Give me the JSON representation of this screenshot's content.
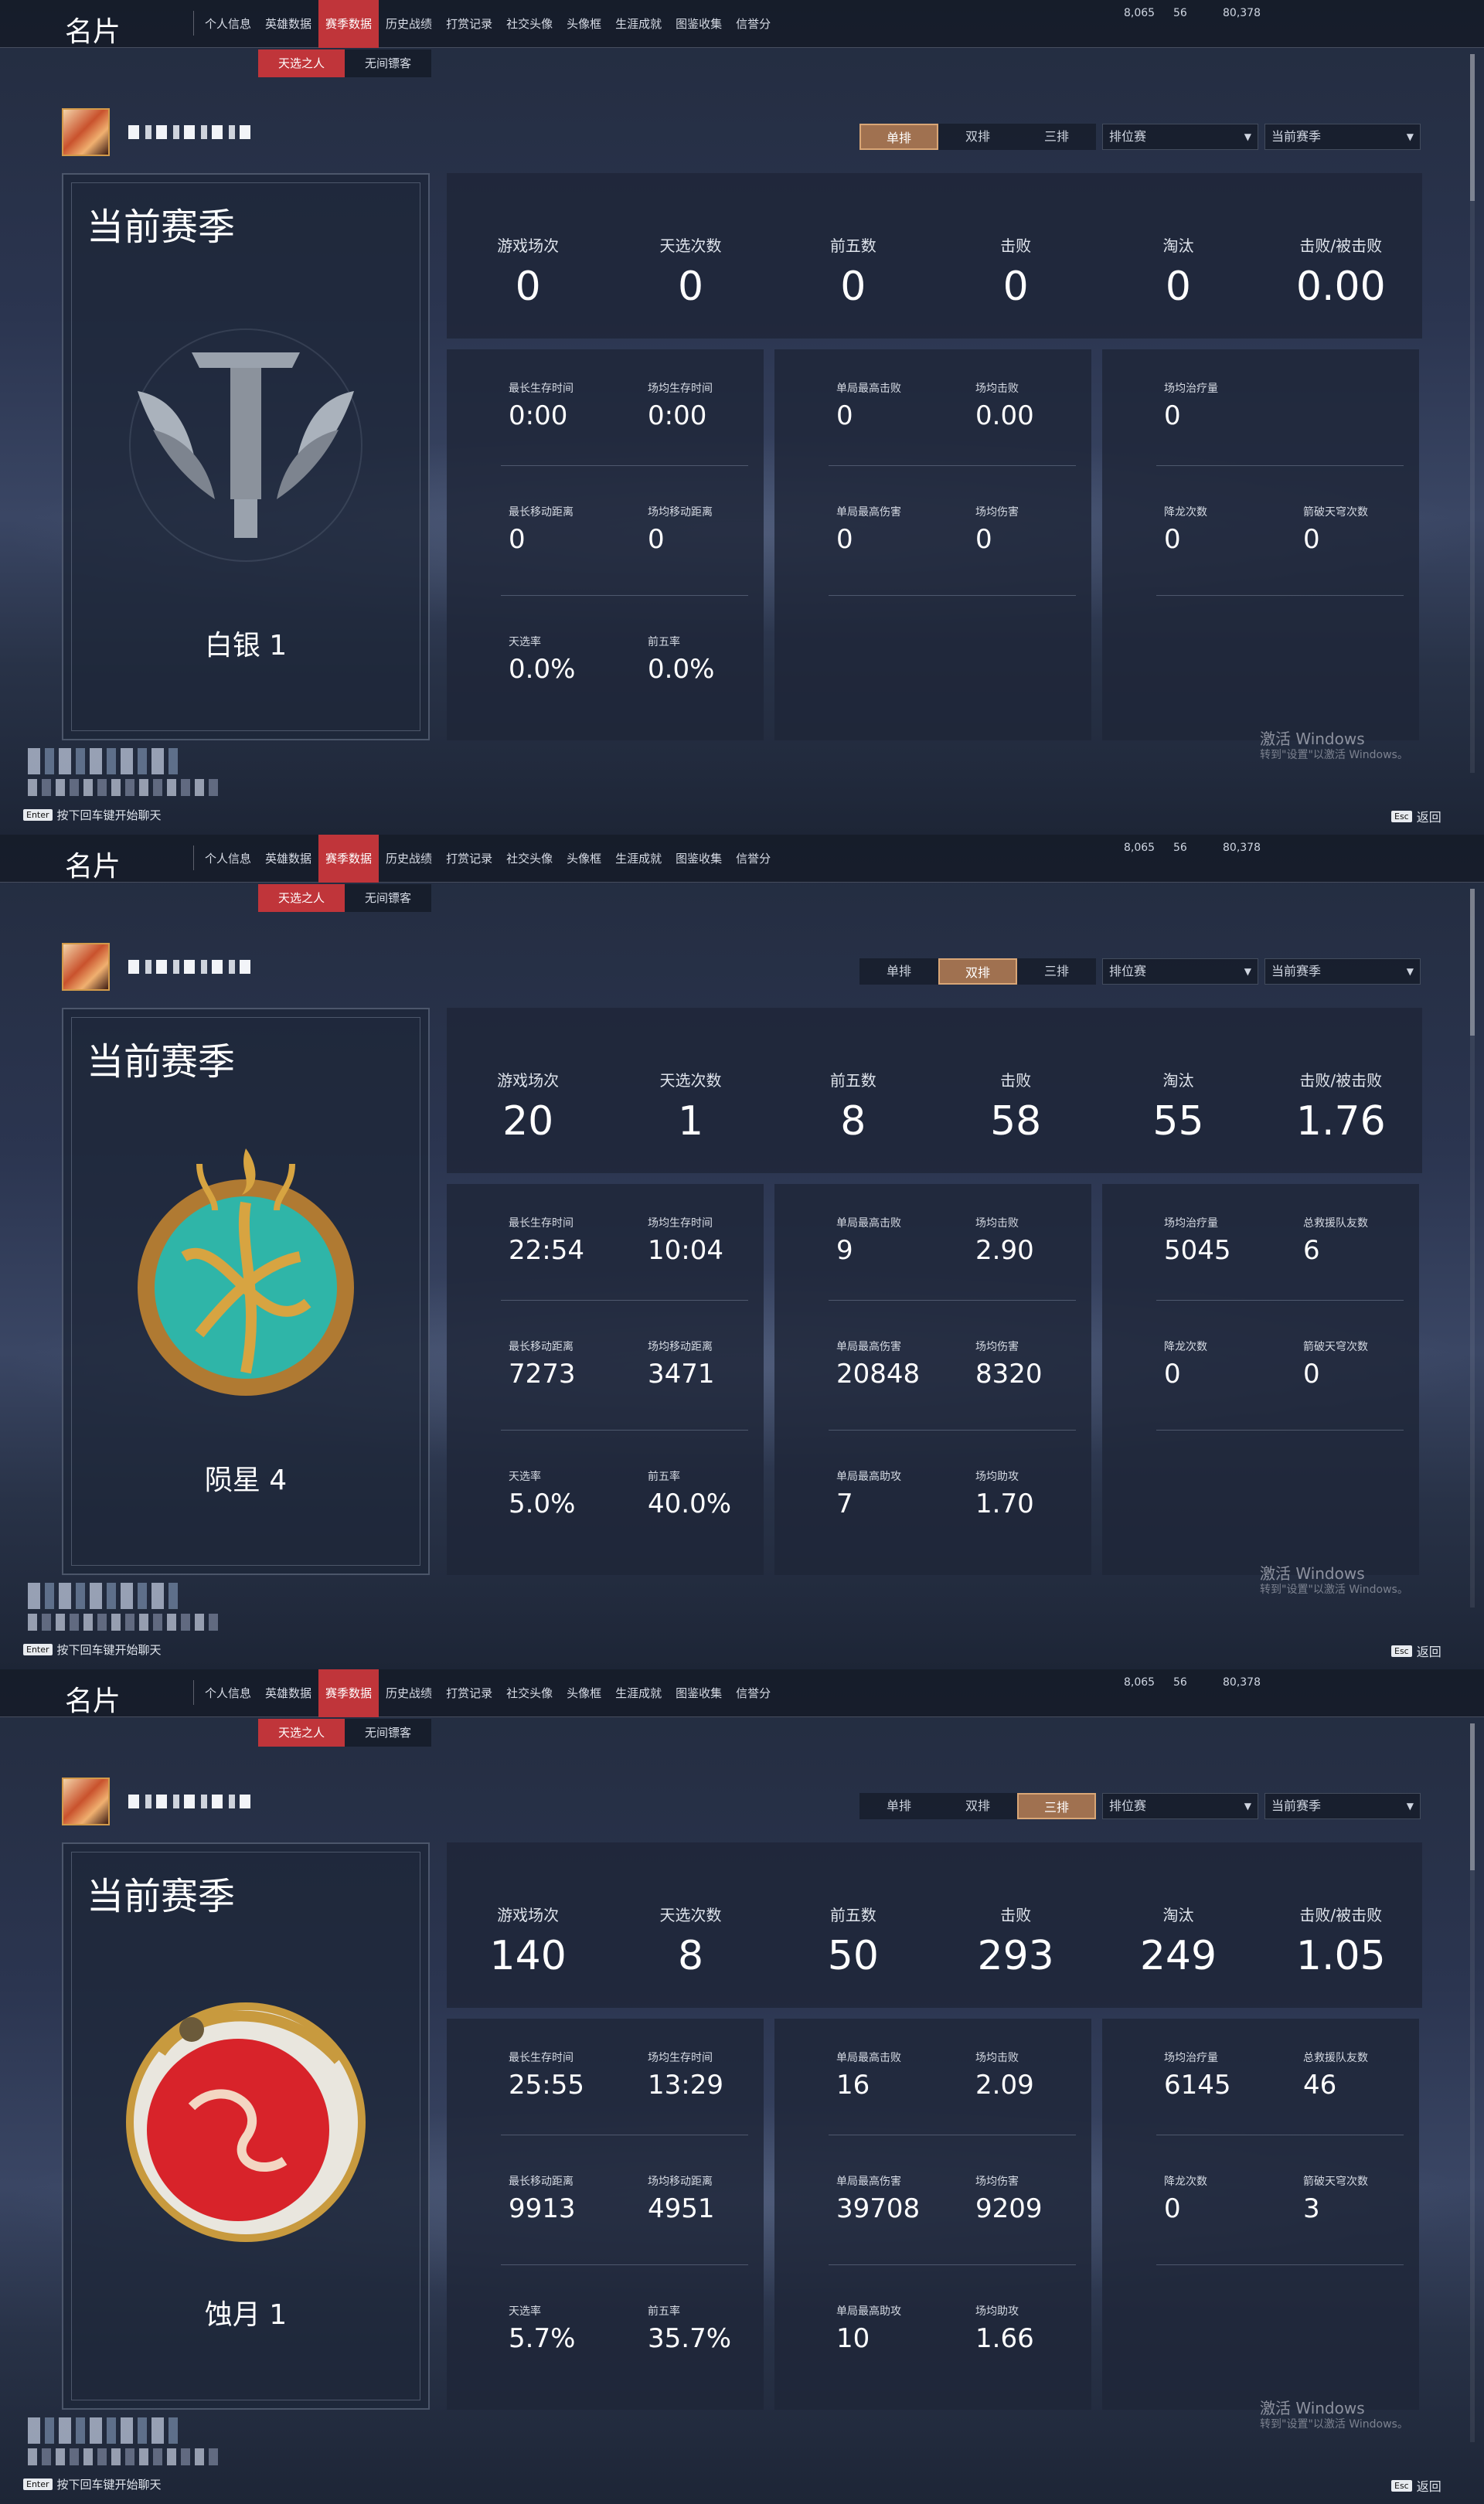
{
  "brand_title": "名片",
  "nav": [
    "个人信息",
    "英雄数据",
    "赛季数据",
    "历史战绩",
    "打赏记录",
    "社交头像",
    "头像框",
    "生涯成就",
    "图鉴收集",
    "信誉分"
  ],
  "subtabs": [
    "天选之人",
    "无间镖客"
  ],
  "currency": [
    {
      "icon": "mask-coin-icon",
      "value": "8,065"
    },
    {
      "icon": "gold-ticket-icon",
      "value": "56"
    },
    {
      "icon": "jade-feather-icon",
      "value": "80,378"
    }
  ],
  "mode_buttons": [
    "单排",
    "双排",
    "三排"
  ],
  "selects": {
    "match_type": "排位赛",
    "season": "当前赛季"
  },
  "season_title": "当前赛季",
  "stat_labels": [
    "游戏场次",
    "天选次数",
    "前五数",
    "击败",
    "淘汰",
    "击败/被击败"
  ],
  "stat_icons": [
    "crossed-swords-icon",
    "lotus-icon",
    "sword-flag-icon",
    "throne-icon",
    "slash-icon",
    "demon-mask-icon"
  ],
  "watermark": {
    "line1": "激活 Windows",
    "line2": "转到\"设置\"以激活 Windows。"
  },
  "chat_hint": {
    "key": "Enter",
    "text": "按下回车键开始聊天"
  },
  "esc": {
    "key": "Esc",
    "text": "返回"
  },
  "panels": [
    {
      "active_mode": 0,
      "rank": "白银 1",
      "emblem": "silver-rank-emblem",
      "stats": [
        "0",
        "0",
        "0",
        "0",
        "0",
        "0.00"
      ],
      "blocks": [
        [
          {
            "l": "最长生存时间",
            "v": "0:00"
          },
          {
            "l": "场均生存时间",
            "v": "0:00"
          },
          {
            "l": "最长移动距离",
            "v": "0"
          },
          {
            "l": "场均移动距离",
            "v": "0"
          },
          {
            "l": "天选率",
            "v": "0.0%"
          },
          {
            "l": "前五率",
            "v": "0.0%"
          }
        ],
        [
          {
            "l": "单局最高击败",
            "v": "0"
          },
          {
            "l": "场均击败",
            "v": "0.00"
          },
          {
            "l": "单局最高伤害",
            "v": "0"
          },
          {
            "l": "场均伤害",
            "v": "0"
          }
        ],
        [
          {
            "l": "场均治疗量",
            "v": "0"
          },
          {
            "l": "",
            "v": ""
          },
          {
            "l": "降龙次数",
            "v": "0"
          },
          {
            "l": "箭破天穹次数",
            "v": "0"
          }
        ]
      ]
    },
    {
      "active_mode": 1,
      "rank": "陨星 4",
      "emblem": "meteor-rank-emblem",
      "stats": [
        "20",
        "1",
        "8",
        "58",
        "55",
        "1.76"
      ],
      "blocks": [
        [
          {
            "l": "最长生存时间",
            "v": "22:54"
          },
          {
            "l": "场均生存时间",
            "v": "10:04"
          },
          {
            "l": "最长移动距离",
            "v": "7273"
          },
          {
            "l": "场均移动距离",
            "v": "3471"
          },
          {
            "l": "天选率",
            "v": "5.0%"
          },
          {
            "l": "前五率",
            "v": "40.0%"
          }
        ],
        [
          {
            "l": "单局最高击败",
            "v": "9"
          },
          {
            "l": "场均击败",
            "v": "2.90"
          },
          {
            "l": "单局最高伤害",
            "v": "20848"
          },
          {
            "l": "场均伤害",
            "v": "8320"
          },
          {
            "l": "单局最高助攻",
            "v": "7"
          },
          {
            "l": "场均助攻",
            "v": "1.70"
          }
        ],
        [
          {
            "l": "场均治疗量",
            "v": "5045"
          },
          {
            "l": "总救援队友数",
            "v": "6"
          },
          {
            "l": "降龙次数",
            "v": "0"
          },
          {
            "l": "箭破天穹次数",
            "v": "0"
          }
        ]
      ]
    },
    {
      "active_mode": 2,
      "rank": "蚀月 1",
      "emblem": "eclipse-rank-emblem",
      "stats": [
        "140",
        "8",
        "50",
        "293",
        "249",
        "1.05"
      ],
      "blocks": [
        [
          {
            "l": "最长生存时间",
            "v": "25:55"
          },
          {
            "l": "场均生存时间",
            "v": "13:29"
          },
          {
            "l": "最长移动距离",
            "v": "9913"
          },
          {
            "l": "场均移动距离",
            "v": "4951"
          },
          {
            "l": "天选率",
            "v": "5.7%"
          },
          {
            "l": "前五率",
            "v": "35.7%"
          }
        ],
        [
          {
            "l": "单局最高击败",
            "v": "16"
          },
          {
            "l": "场均击败",
            "v": "2.09"
          },
          {
            "l": "单局最高伤害",
            "v": "39708"
          },
          {
            "l": "场均伤害",
            "v": "9209"
          },
          {
            "l": "单局最高助攻",
            "v": "10"
          },
          {
            "l": "场均助攻",
            "v": "1.66"
          }
        ],
        [
          {
            "l": "场均治疗量",
            "v": "6145"
          },
          {
            "l": "总救援队友数",
            "v": "46"
          },
          {
            "l": "降龙次数",
            "v": "0"
          },
          {
            "l": "箭破天穹次数",
            "v": "3"
          }
        ]
      ]
    }
  ]
}
